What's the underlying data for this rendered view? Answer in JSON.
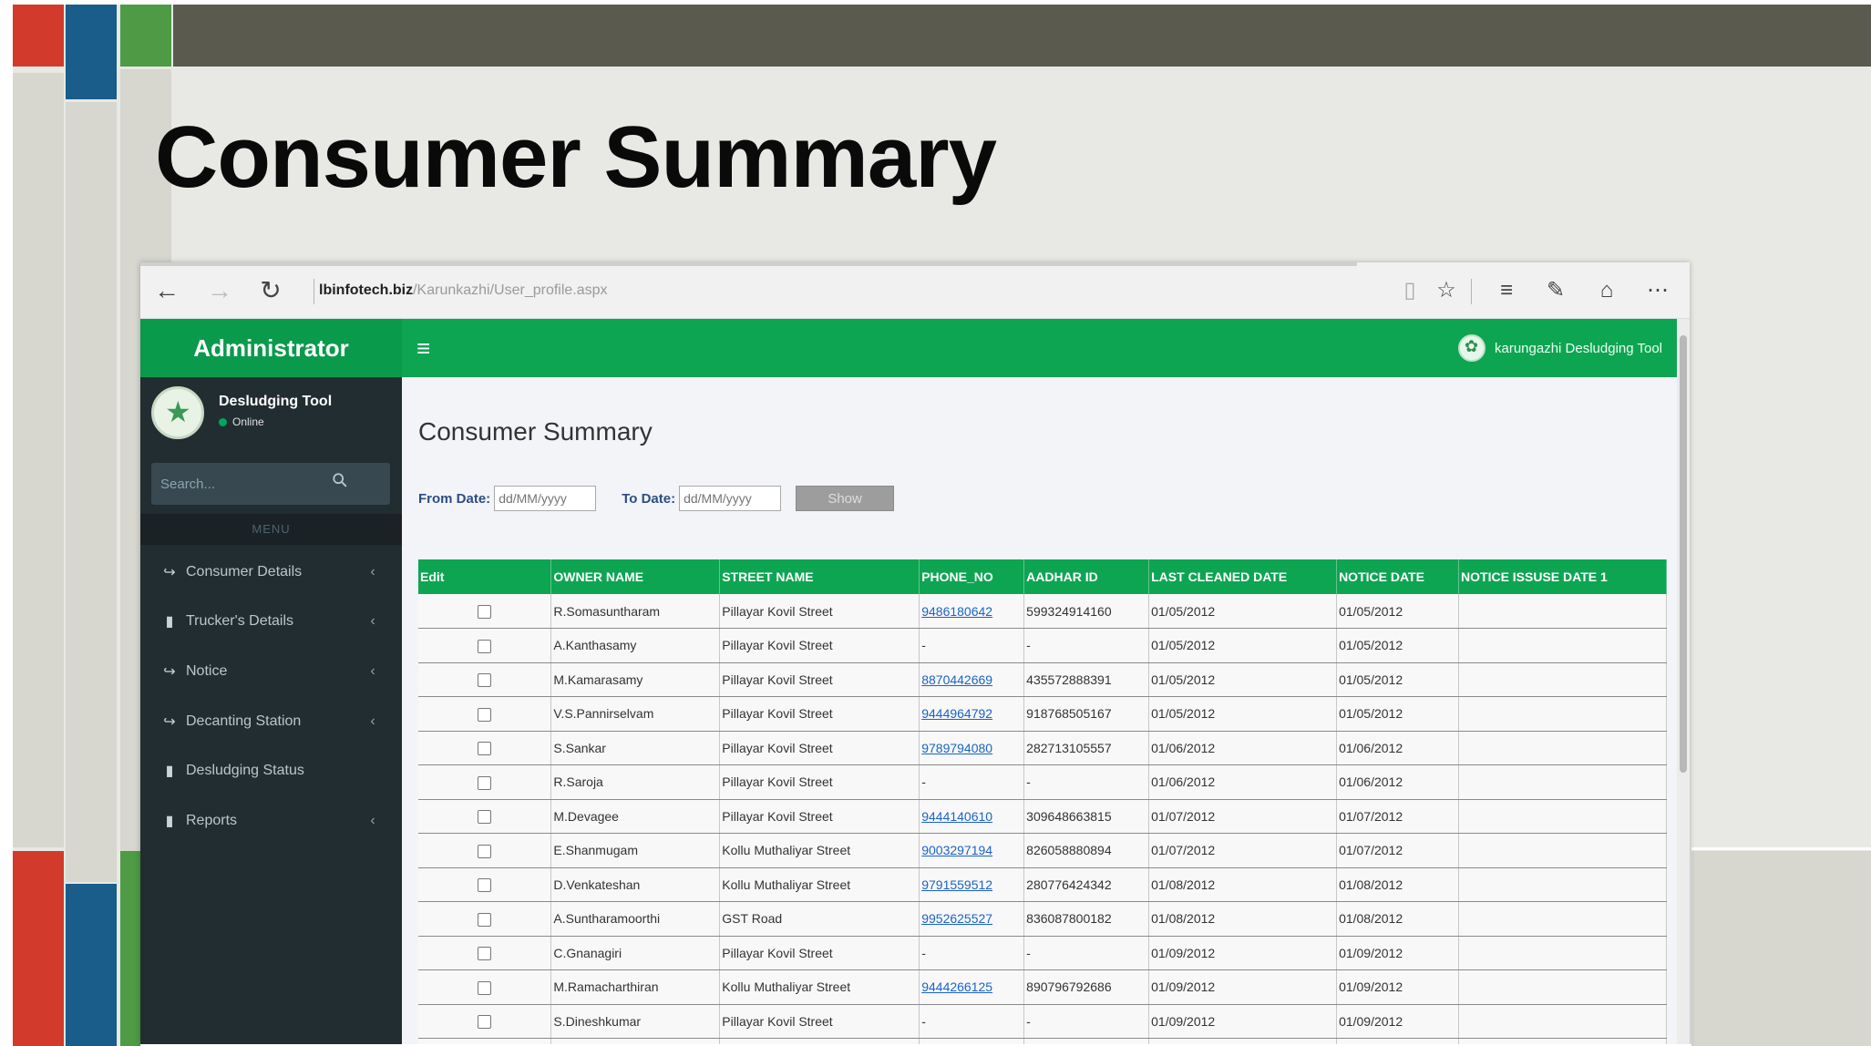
{
  "slide": {
    "title": "Consumer Summary"
  },
  "browser": {
    "url_host": "lbinfotech.biz",
    "url_path": "/Karunkazhi/User_profile.aspx"
  },
  "app": {
    "brand": "Administrator",
    "header_right_text": "karungazhi Desludging Tool",
    "user_name": "Desludging Tool",
    "user_status": "Online",
    "search_placeholder": "Search...",
    "menu_header": "MENU",
    "menu_items": [
      {
        "label": "Consumer Details",
        "icon": "share-icon",
        "chevron": true
      },
      {
        "label": "Trucker's Details",
        "icon": "book-icon",
        "chevron": true
      },
      {
        "label": "Notice",
        "icon": "share-icon",
        "chevron": true
      },
      {
        "label": "Decanting Station",
        "icon": "share-icon",
        "chevron": true
      },
      {
        "label": "Desludging Status",
        "icon": "book-icon",
        "chevron": false
      },
      {
        "label": "Reports",
        "icon": "book-icon",
        "chevron": true
      }
    ]
  },
  "main": {
    "page_title": "Consumer Summary",
    "from_label": "From Date:",
    "from_placeholder": "dd/MM/yyyy",
    "to_label": "To Date:",
    "to_placeholder": "dd/MM/yyyy",
    "show_label": "Show",
    "columns": [
      "Edit",
      "OWNER NAME",
      "STREET NAME",
      "PHONE_NO",
      "AADHAR ID",
      "LAST CLEANED DATE",
      "NOTICE DATE",
      "NOTICE ISSUSE DATE 1"
    ],
    "rows": [
      {
        "owner": "R.Somasuntharam",
        "street": "Pillayar Kovil Street",
        "phone": "9486180642",
        "aadhar": "599324914160",
        "last_cleaned": "01/05/2012",
        "notice": "01/05/2012",
        "notice_issue": ""
      },
      {
        "owner": "A.Kanthasamy",
        "street": "Pillayar Kovil Street",
        "phone": "-",
        "aadhar": "-",
        "last_cleaned": "01/05/2012",
        "notice": "01/05/2012",
        "notice_issue": ""
      },
      {
        "owner": "M.Kamarasamy",
        "street": "Pillayar Kovil Street",
        "phone": "8870442669",
        "aadhar": "435572888391",
        "last_cleaned": "01/05/2012",
        "notice": "01/05/2012",
        "notice_issue": ""
      },
      {
        "owner": "V.S.Pannirselvam",
        "street": "Pillayar Kovil Street",
        "phone": "9444964792",
        "aadhar": "918768505167",
        "last_cleaned": "01/05/2012",
        "notice": "01/05/2012",
        "notice_issue": ""
      },
      {
        "owner": "S.Sankar",
        "street": "Pillayar Kovil Street",
        "phone": "9789794080",
        "aadhar": "282713105557",
        "last_cleaned": "01/06/2012",
        "notice": "01/06/2012",
        "notice_issue": ""
      },
      {
        "owner": "R.Saroja",
        "street": "Pillayar Kovil Street",
        "phone": "-",
        "aadhar": "-",
        "last_cleaned": "01/06/2012",
        "notice": "01/06/2012",
        "notice_issue": ""
      },
      {
        "owner": "M.Devagee",
        "street": "Pillayar Kovil Street",
        "phone": "9444140610",
        "aadhar": "309648663815",
        "last_cleaned": "01/07/2012",
        "notice": "01/07/2012",
        "notice_issue": ""
      },
      {
        "owner": "E.Shanmugam",
        "street": "Kollu Muthaliyar Street",
        "phone": "9003297194",
        "aadhar": "826058880894",
        "last_cleaned": "01/07/2012",
        "notice": "01/07/2012",
        "notice_issue": ""
      },
      {
        "owner": "D.Venkateshan",
        "street": "Kollu Muthaliyar Street",
        "phone": "9791559512",
        "aadhar": "280776424342",
        "last_cleaned": "01/08/2012",
        "notice": "01/08/2012",
        "notice_issue": ""
      },
      {
        "owner": "A.Suntharamoorthi",
        "street": "GST Road",
        "phone": "9952625527",
        "aadhar": "836087800182",
        "last_cleaned": "01/08/2012",
        "notice": "01/08/2012",
        "notice_issue": ""
      },
      {
        "owner": "C.Gnanagiri",
        "street": "Pillayar Kovil Street",
        "phone": "-",
        "aadhar": "-",
        "last_cleaned": "01/09/2012",
        "notice": "01/09/2012",
        "notice_issue": ""
      },
      {
        "owner": "M.Ramacharthiran",
        "street": "Kollu Muthaliyar Street",
        "phone": "9444266125",
        "aadhar": "890796792686",
        "last_cleaned": "01/09/2012",
        "notice": "01/09/2012",
        "notice_issue": ""
      },
      {
        "owner": "S.Dineshkumar",
        "street": "Pillayar Kovil Street",
        "phone": "-",
        "aadhar": "-",
        "last_cleaned": "01/09/2012",
        "notice": "01/09/2012",
        "notice_issue": ""
      },
      {
        "owner": "",
        "street": "",
        "phone": "",
        "aadhar": "",
        "last_cleaned": "",
        "notice": "",
        "notice_issue": ""
      }
    ]
  },
  "colors": {
    "accent_green": "#0ea552",
    "sidebar": "#222d32",
    "slide_red": "#d23a2c",
    "slide_blue": "#1a5c8a",
    "slide_green": "#4e9a45",
    "slide_band": "#5a5a4f"
  }
}
